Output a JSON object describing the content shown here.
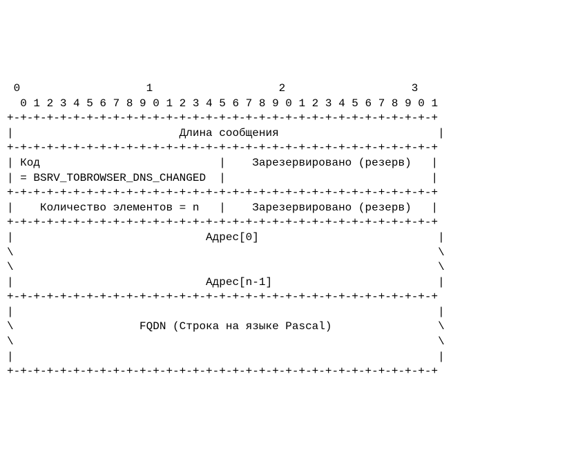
{
  "ruler": {
    "tens": " 0                   1                   2                   3",
    "ones": "  0 1 2 3 4 5 6 7 8 9 0 1 2 3 4 5 6 7 8 9 0 1 2 3 4 5 6 7 8 9 0 1"
  },
  "border": "+-+-+-+-+-+-+-+-+-+-+-+-+-+-+-+-+-+-+-+-+-+-+-+-+-+-+-+-+-+-+-+-+",
  "row_len": "|                         Длина сообщения                        |",
  "row_code1": "| Код                           |    Зарезервировано (резерв)   |",
  "row_code2": "| = BSRV_TOBROWSER_DNS_CHANGED  |                               |",
  "row_count": "|    Количество элементов = n   |    Зарезервировано (резерв)   |",
  "row_addr0": "|                             Адрес[0]                           |",
  "row_slash": "\\                                                                \\",
  "row_addrn": "|                             Адрес[n-1]                         |",
  "row_pipe": "|                                                                |",
  "row_fqdn": "\\                   FQDN (Строка на языке Pascal)                \\"
}
